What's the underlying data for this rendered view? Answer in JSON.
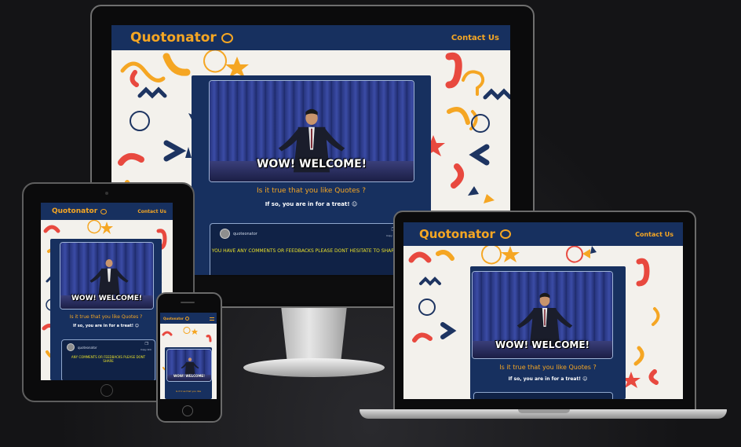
{
  "site": {
    "brand": "Quotonator",
    "contact": "Contact Us",
    "gif_caption": "WOW! WELCOME!",
    "question": "Is it true that you like Quotes ?",
    "invite": "If so, you are in for a treat! ☺",
    "comment_user": "quoteonator",
    "comment_copy": "Copy link",
    "comment_message_desktop": "YOU HAVE ANY COMMENTS OR FEEDBACKS PLEASE DONT HESITATE TO SHARE",
    "comment_message_tablet": "ANY COMMENTS OR FEEDBACKS PLEASE DONT SHARE",
    "phone_question": "Is it true that you like"
  },
  "colors": {
    "navy": "#17305f",
    "accent": "#f5a623",
    "pattern_red": "#e8493f",
    "pattern_yellow": "#f5a623",
    "pattern_navy": "#1d3461",
    "comment_text": "#e8e02a",
    "page_bg": "#141416"
  },
  "devices": [
    "desktop-monitor",
    "laptop",
    "tablet",
    "phone"
  ]
}
